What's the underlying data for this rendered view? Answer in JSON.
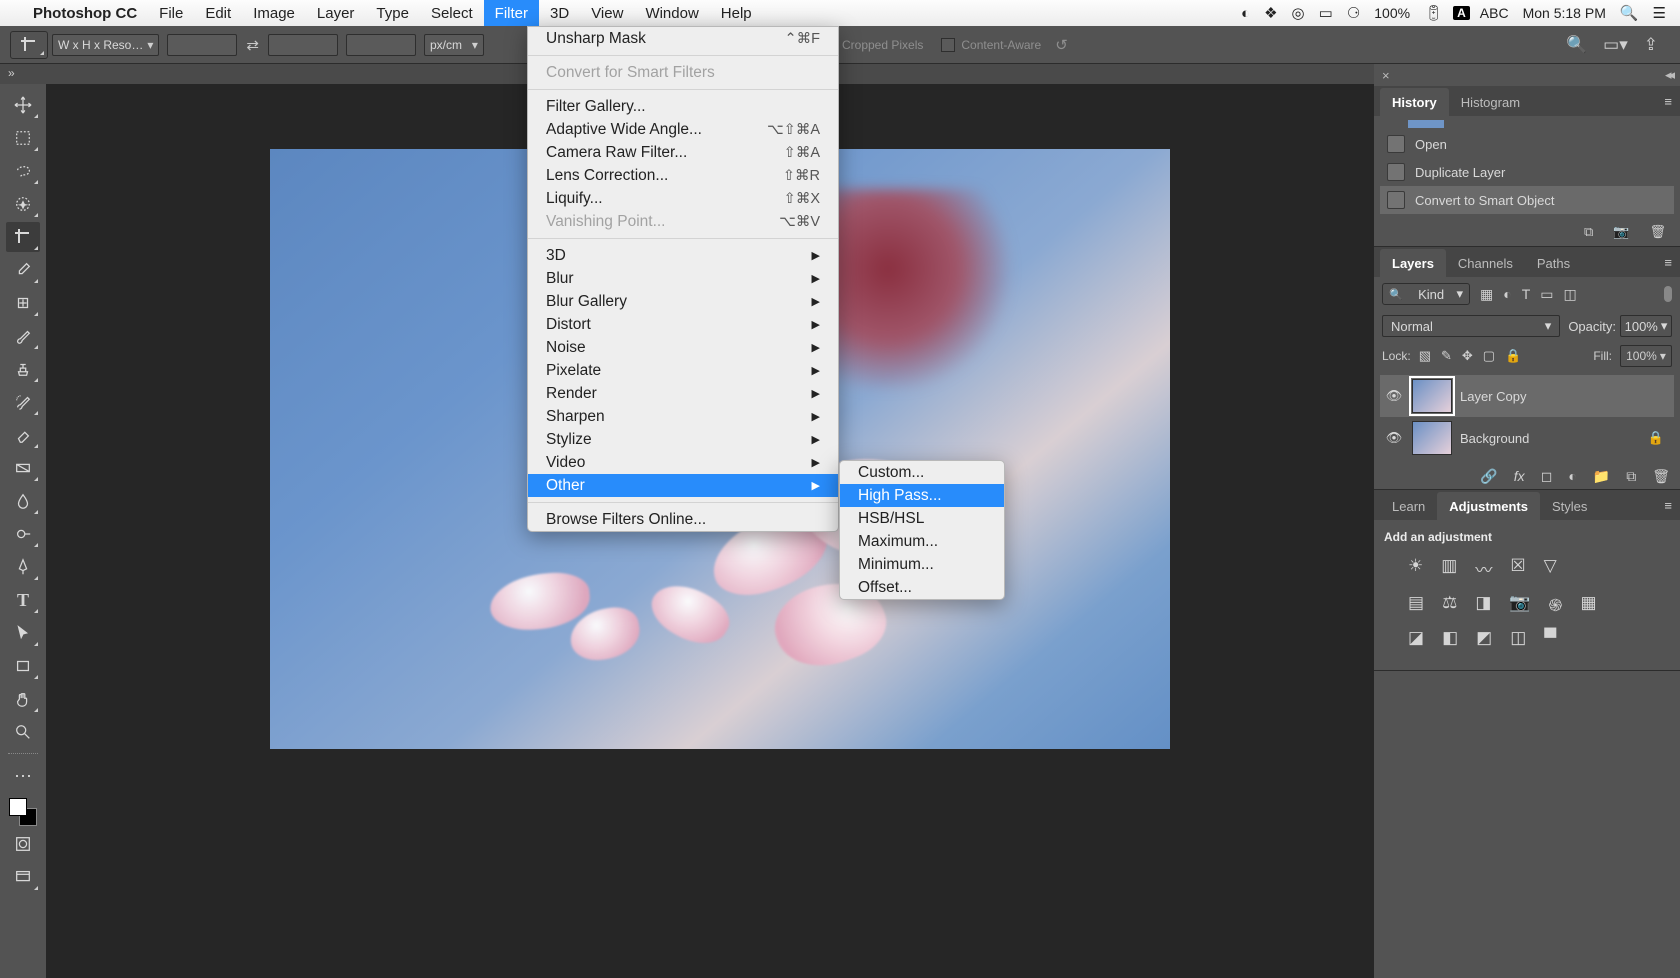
{
  "menubar": {
    "app": "Photoshop CC",
    "items": [
      "File",
      "Edit",
      "Image",
      "Layer",
      "Type",
      "Select",
      "Filter",
      "3D",
      "View",
      "Window",
      "Help"
    ],
    "active": "Filter",
    "battery": "100%",
    "input": "ABC",
    "clock": "Mon 5:18 PM"
  },
  "optionsbar": {
    "ratio_combo": "W x H x Reso…",
    "unit": "px/cm",
    "cropped_pixels": "Cropped Pixels",
    "content_aware": "Content-Aware"
  },
  "filter_menu": {
    "last_filter": {
      "label": "Unsharp Mask",
      "shortcut": "⌃⌘F"
    },
    "smart": "Convert for Smart Filters",
    "g1": [
      {
        "label": "Filter Gallery...",
        "sc": ""
      },
      {
        "label": "Adaptive Wide Angle...",
        "sc": "⌥⇧⌘A"
      },
      {
        "label": "Camera Raw Filter...",
        "sc": "⇧⌘A"
      },
      {
        "label": "Lens Correction...",
        "sc": "⇧⌘R"
      },
      {
        "label": "Liquify...",
        "sc": "⇧⌘X"
      },
      {
        "label": "Vanishing Point...",
        "sc": "⌥⌘V",
        "disabled": true
      }
    ],
    "subs": [
      "3D",
      "Blur",
      "Blur Gallery",
      "Distort",
      "Noise",
      "Pixelate",
      "Render",
      "Sharpen",
      "Stylize",
      "Video",
      "Other"
    ],
    "browse": "Browse Filters Online..."
  },
  "other_menu": {
    "items": [
      "Custom...",
      "High Pass...",
      "HSB/HSL",
      "Maximum...",
      "Minimum...",
      "Offset..."
    ],
    "hilite": "High Pass..."
  },
  "panels": {
    "history": {
      "tab1": "History",
      "tab2": "Histogram",
      "rows": [
        "Open",
        "Duplicate Layer",
        "Convert to Smart Object"
      ]
    },
    "layers": {
      "tab1": "Layers",
      "tab2": "Channels",
      "tab3": "Paths",
      "kind": "Kind",
      "blend": "Normal",
      "opacity_lbl": "Opacity:",
      "opacity": "100%",
      "lock_lbl": "Lock:",
      "fill_lbl": "Fill:",
      "fill": "100%",
      "layer1": "Layer Copy",
      "layer2": "Background"
    },
    "learn": {
      "tab1": "Learn",
      "tab2": "Adjustments",
      "tab3": "Styles",
      "title": "Add an adjustment"
    }
  }
}
